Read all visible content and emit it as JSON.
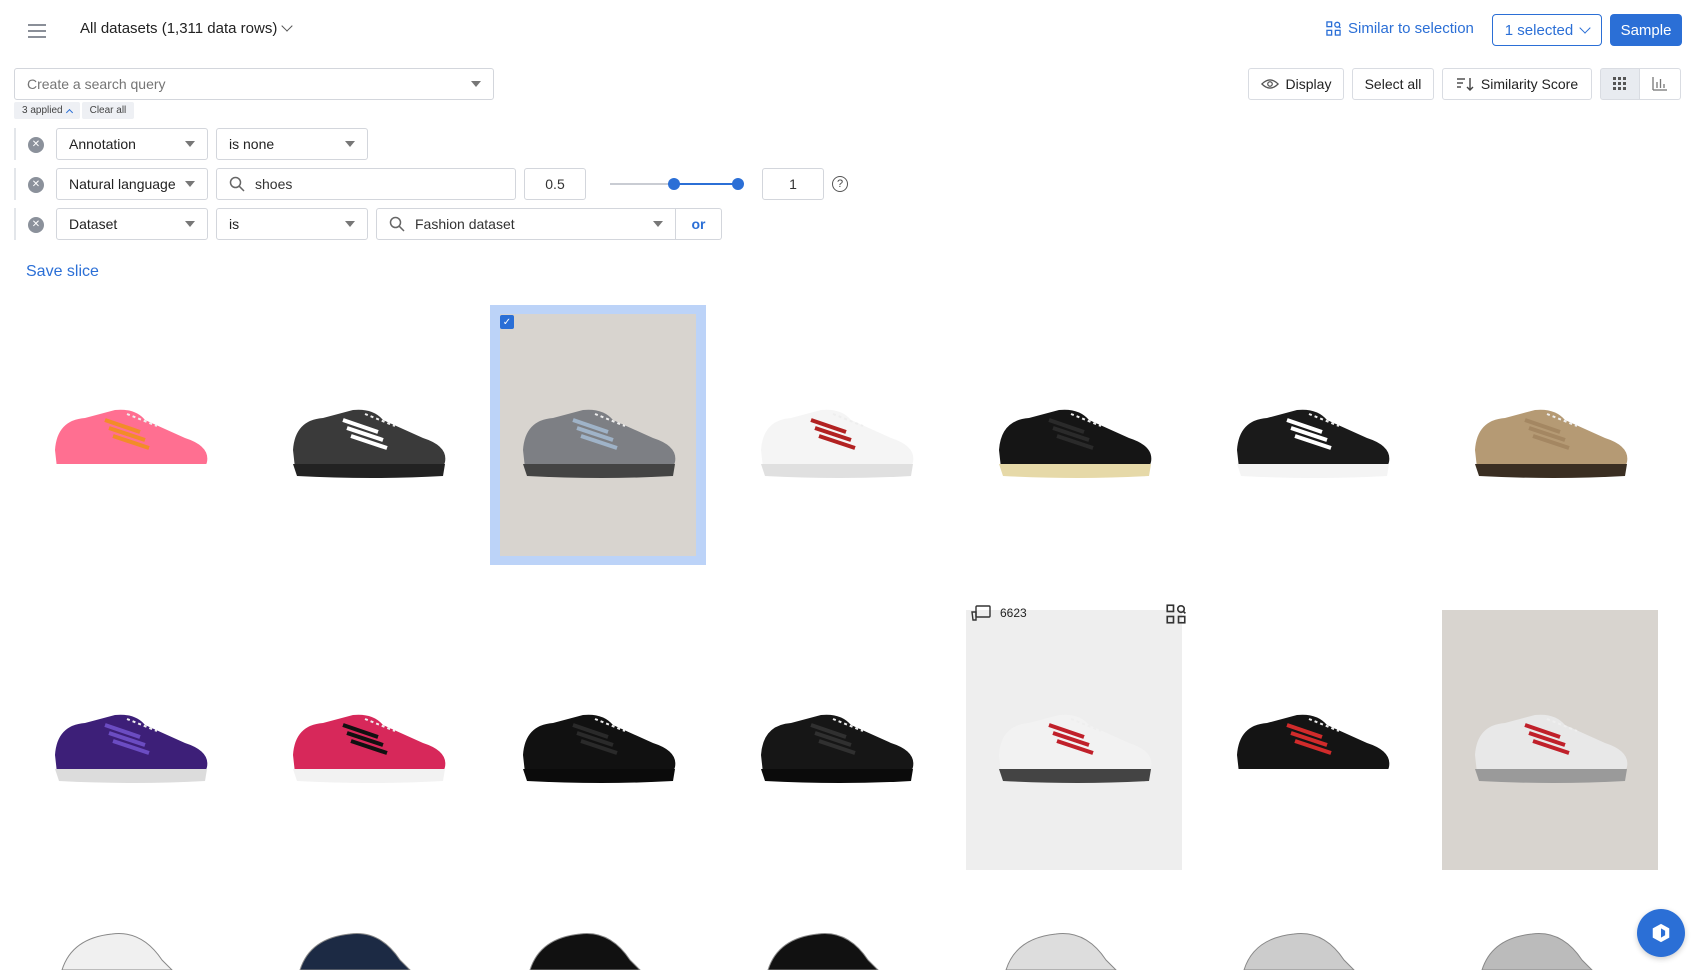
{
  "header": {
    "dataset_label": "All datasets (1,311 data rows)",
    "similar_label": "Similar to selection",
    "selected_label": "1 selected",
    "sample_label": "Sample"
  },
  "search": {
    "placeholder": "Create a search query",
    "applied_label": "3 applied",
    "clear_label": "Clear all"
  },
  "toolbar": {
    "display_label": "Display",
    "select_all_label": "Select all",
    "sort_label": "Similarity Score"
  },
  "filters": [
    {
      "field": "Annotation",
      "operator": "is none"
    },
    {
      "field": "Natural language",
      "query": "shoes",
      "min": "0.5",
      "max": "1",
      "range_low": 0.5,
      "range_high": 1
    },
    {
      "field": "Dataset",
      "operator": "is",
      "value": "Fashion dataset",
      "or_label": "or"
    }
  ],
  "save_slice_label": "Save slice",
  "hover_item": {
    "id": "6623"
  },
  "colors": {
    "accent": "#2b6fd6",
    "selection": "#bcd3f8"
  },
  "grid": {
    "row1": [
      {
        "color": "#ff6f91",
        "sole": "#ffffff",
        "stripe": "#f28c28"
      },
      {
        "color": "#3a3a3a",
        "sole": "#222222",
        "stripe": "#ffffff"
      },
      {
        "color": "#7d7f84",
        "sole": "#444444",
        "stripe": "#9fb3c8"
      },
      {
        "color": "#f5f5f5",
        "sole": "#e0e0e0",
        "stripe": "#b22222"
      },
      {
        "color": "#151515",
        "sole": "#e6d9a8",
        "stripe": "#2a2a2a"
      },
      {
        "color": "#1a1a1a",
        "sole": "#f4f4f4",
        "stripe": "#ffffff"
      },
      {
        "color": "#b59a74",
        "sole": "#3a2e22",
        "stripe": "#a48762"
      }
    ],
    "row2": [
      {
        "color": "#3d1f78",
        "sole": "#dcdcdc",
        "stripe": "#6b4cc2"
      },
      {
        "color": "#d7285a",
        "sole": "#f2f2f2",
        "stripe": "#111111"
      },
      {
        "color": "#111111",
        "sole": "#0b0b0b",
        "stripe": "#2a2a2a"
      },
      {
        "color": "#161616",
        "sole": "#0b0b0b",
        "stripe": "#303030"
      },
      {
        "color": "#f2f2f2",
        "sole": "#444444",
        "stripe": "#c0202a"
      },
      {
        "color": "#141414",
        "sole": "#ffffff",
        "stripe": "#d12b2b"
      },
      {
        "color": "#e8e8e8",
        "sole": "#9a9a9a",
        "stripe": "#c0202a"
      }
    ]
  }
}
